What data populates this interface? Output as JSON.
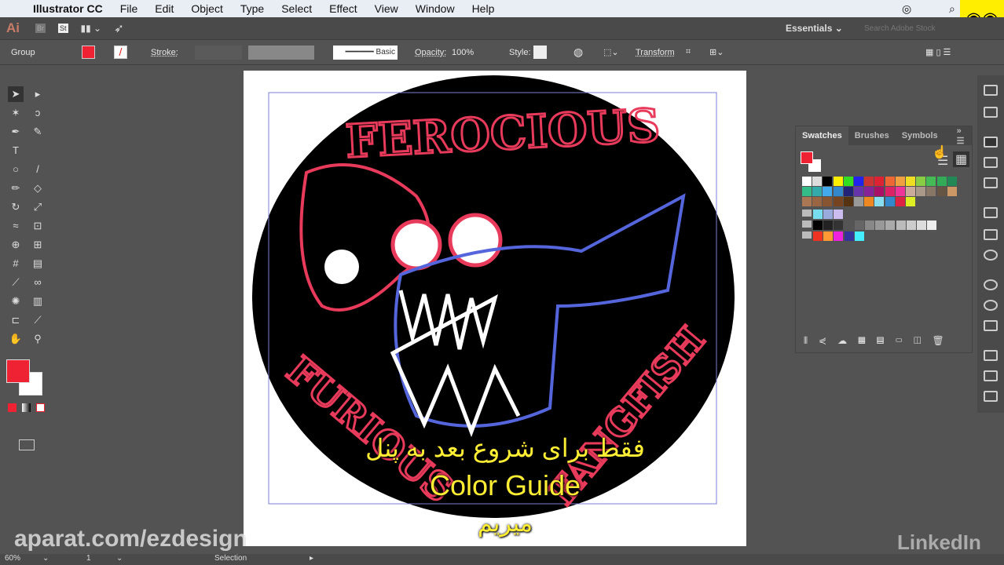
{
  "menubar": {
    "app": "Illustrator CC",
    "items": [
      "File",
      "Edit",
      "Object",
      "Type",
      "Select",
      "Effect",
      "View",
      "Window",
      "Help"
    ]
  },
  "appbar": {
    "ai": "Ai",
    "br": "Br",
    "st": "St",
    "workspace": "Essentials",
    "search_placeholder": "Search Adobe Stock"
  },
  "control": {
    "selection": "Group",
    "stroke_label": "Stroke:",
    "brush": "Basic",
    "opacity_label": "Opacity:",
    "opacity_value": "100%",
    "style_label": "Style:",
    "transform": "Transform",
    "fill_color": "#ee2233"
  },
  "swatches": {
    "tabs": [
      "Swatches",
      "Brushes",
      "Symbols"
    ],
    "rows": [
      [
        "#ffffff",
        "#dddddd",
        "#000000",
        "#ffee00",
        "#33dd22",
        "#2222ee",
        "#cc3333",
        "#dd2233",
        "#ee6633",
        "#f0a040",
        "#eedd22",
        "#88cc44",
        "#44bb55",
        "#33aa55",
        "#228855"
      ],
      [
        "#33bb88",
        "#33aaaa",
        "#44aaee",
        "#3388cc",
        "#222277",
        "#6633aa",
        "#882299",
        "#aa1166",
        "#dd2266",
        "#ee3399",
        "#ccaa99",
        "#aa9988",
        "#887766",
        "#665544",
        "#cc9966"
      ],
      [
        "#aa7755",
        "#996644",
        "#885533",
        "#774422",
        "#553311",
        "#999999",
        "#ee8822",
        "#88ddee",
        "#3388cc",
        "#dd2244",
        "#ddee22"
      ],
      [
        "#77ddee",
        "#99aadd",
        "#ccbbee"
      ],
      [
        "#000000",
        "#222222",
        "#333333",
        "#555555",
        "#666666",
        "#888888",
        "#999999",
        "#aaaaaa",
        "#bbbbbb",
        "#cccccc",
        "#dddddd",
        "#eeeeee"
      ],
      [
        "#ee3322",
        "#ff9933",
        "#ee22dd",
        "#333399",
        "#44eeff"
      ]
    ]
  },
  "artwork": {
    "logo_top": "FEROCIOUS",
    "logo_bottom_left": "FURIOUS",
    "logo_bottom_right": "FANGFISH"
  },
  "subtitles": {
    "line1": "فقط برای شروع بعد به پنل",
    "line2": "Color Guide",
    "line3": "میریم"
  },
  "watermark": {
    "aparat": "aparat.com/ezdesign",
    "linkedin": "LinkedIn"
  },
  "status": {
    "zoom": "60%",
    "artboard": "1",
    "tool": "Selection"
  }
}
